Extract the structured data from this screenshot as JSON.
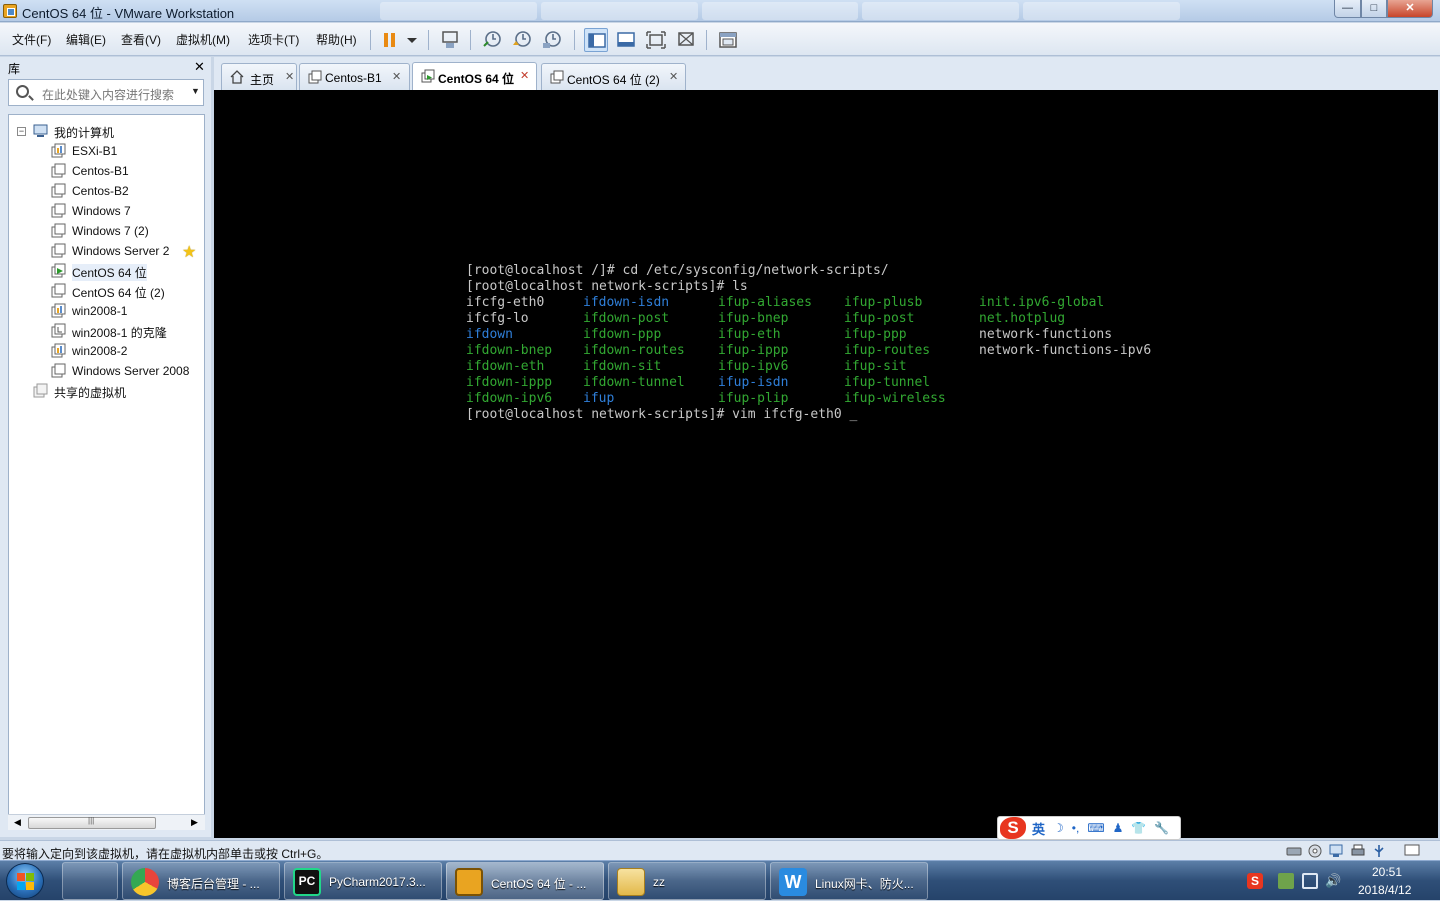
{
  "window": {
    "title": "CentOS 64 位 - VMware Workstation",
    "min": "—",
    "max": "□",
    "close": "✕"
  },
  "menu": [
    "文件(F)",
    "编辑(E)",
    "查看(V)",
    "虚拟机(M)",
    "选项卡(T)",
    "帮助(H)"
  ],
  "toolbar": {
    "buttons": [
      "pause-icon",
      "dropdown-arrow-icon",
      "send-ctrl-alt-del-icon",
      "snapshot-icon",
      "revert-snapshot-icon",
      "snapshot-manager-icon",
      "show-library-icon",
      "quick-switch-icon",
      "fullscreen-icon",
      "unity-icon",
      "console-view-icon"
    ]
  },
  "library": {
    "title": "库",
    "close": "✕",
    "search_placeholder": "在此处键入内容进行搜索",
    "tree": [
      {
        "label": "我的计算机",
        "level": 0,
        "icon": "computer-icon",
        "expanded": true
      },
      {
        "label": "ESXi-B1",
        "level": 1,
        "icon": "esxi-icon"
      },
      {
        "label": "Centos-B1",
        "level": 1,
        "icon": "vm-icon"
      },
      {
        "label": "Centos-B2",
        "level": 1,
        "icon": "vm-icon"
      },
      {
        "label": "Windows 7",
        "level": 1,
        "icon": "vm-icon"
      },
      {
        "label": "Windows 7 (2)",
        "level": 1,
        "icon": "vm-icon"
      },
      {
        "label": "Windows Server 2",
        "level": 1,
        "icon": "vm-icon",
        "favorite": true
      },
      {
        "label": "CentOS 64 位",
        "level": 1,
        "icon": "vm-running-icon",
        "selected": true
      },
      {
        "label": "CentOS 64 位 (2)",
        "level": 1,
        "icon": "vm-icon"
      },
      {
        "label": "win2008-1",
        "level": 1,
        "icon": "esxi-icon"
      },
      {
        "label": "win2008-1 的克隆",
        "level": 1,
        "icon": "vm-clone-icon"
      },
      {
        "label": "win2008-2",
        "level": 1,
        "icon": "esxi-icon"
      },
      {
        "label": "Windows Server 2008",
        "level": 1,
        "icon": "vm-icon"
      },
      {
        "label": "共享的虚拟机",
        "level": 0,
        "icon": "shared-vms-icon"
      }
    ]
  },
  "tabs": [
    {
      "label": "主页",
      "icon": "home-icon",
      "active": false
    },
    {
      "label": "Centos-B1",
      "icon": "vm-icon",
      "active": false
    },
    {
      "label": "CentOS 64 位",
      "icon": "vm-icon",
      "active": true
    },
    {
      "label": "CentOS 64 位 (2)",
      "icon": "vm-icon",
      "active": false
    }
  ],
  "terminal": {
    "prompt_lines": [
      "[root@localhost /]# cd /etc/sysconfig/network-scripts/",
      "[root@localhost network-scripts]# ls"
    ],
    "ls_rows": [
      [
        [
          "ifcfg-eth0",
          "white"
        ],
        [
          "ifdown-isdn",
          "blue"
        ],
        [
          "ifup-aliases",
          "green"
        ],
        [
          "ifup-plusb",
          "green"
        ],
        [
          "init.ipv6-global",
          "green"
        ]
      ],
      [
        [
          "ifcfg-lo",
          "white"
        ],
        [
          "ifdown-post",
          "green"
        ],
        [
          "ifup-bnep",
          "green"
        ],
        [
          "ifup-post",
          "green"
        ],
        [
          "net.hotplug",
          "green"
        ]
      ],
      [
        [
          "ifdown",
          "blue"
        ],
        [
          "ifdown-ppp",
          "green"
        ],
        [
          "ifup-eth",
          "green"
        ],
        [
          "ifup-ppp",
          "green"
        ],
        [
          "network-functions",
          "white"
        ]
      ],
      [
        [
          "ifdown-bnep",
          "green"
        ],
        [
          "ifdown-routes",
          "green"
        ],
        [
          "ifup-ippp",
          "green"
        ],
        [
          "ifup-routes",
          "green"
        ],
        [
          "network-functions-ipv6",
          "white"
        ]
      ],
      [
        [
          "ifdown-eth",
          "green"
        ],
        [
          "ifdown-sit",
          "green"
        ],
        [
          "ifup-ipv6",
          "green"
        ],
        [
          "ifup-sit",
          "green"
        ],
        [
          "",
          "white"
        ]
      ],
      [
        [
          "ifdown-ippp",
          "green"
        ],
        [
          "ifdown-tunnel",
          "green"
        ],
        [
          "ifup-isdn",
          "blue"
        ],
        [
          "ifup-tunnel",
          "green"
        ],
        [
          "",
          "white"
        ]
      ],
      [
        [
          "ifdown-ipv6",
          "green"
        ],
        [
          "ifup",
          "blue"
        ],
        [
          "ifup-plip",
          "green"
        ],
        [
          "ifup-wireless",
          "green"
        ],
        [
          "",
          "white"
        ]
      ]
    ],
    "last_line": "[root@localhost network-scripts]# vim ifcfg-eth0 _",
    "colors": {
      "green": "#32a832",
      "blue": "#2f7fd9",
      "white": "#c8c8c8"
    }
  },
  "ime": {
    "logo": "S",
    "lang": "英",
    "icons": [
      "☽",
      "•,",
      "⌨",
      "♟",
      "👕",
      "🔧"
    ]
  },
  "status": {
    "text": "要将输入定向到该虚拟机，请在虚拟机内部单击或按 Ctrl+G。",
    "devices": [
      "hdd-icon",
      "cd-icon",
      "network-icon",
      "printer-icon",
      "usb-icon",
      "message-icon"
    ]
  },
  "taskbar": {
    "items": [
      {
        "label": "",
        "icon": "explorer-app-icon",
        "color": "#8c6b3e"
      },
      {
        "label": "博客后台管理 - ...",
        "icon": "chrome-icon",
        "color": "#e8453c"
      },
      {
        "label": "PyCharm2017.3...",
        "icon": "pycharm-icon",
        "color": "#21d789"
      },
      {
        "label": "CentOS 64 位 - ...",
        "icon": "vmware-icon",
        "color": "#e9a421",
        "active": true
      },
      {
        "label": "zz",
        "icon": "folder-icon",
        "color": "#f1cf6b"
      },
      {
        "label": "Linux网卡、防火...",
        "icon": "word-icon",
        "color": "#2a8be0"
      }
    ],
    "clock_time": "20:51",
    "clock_date": "2018/4/12"
  }
}
